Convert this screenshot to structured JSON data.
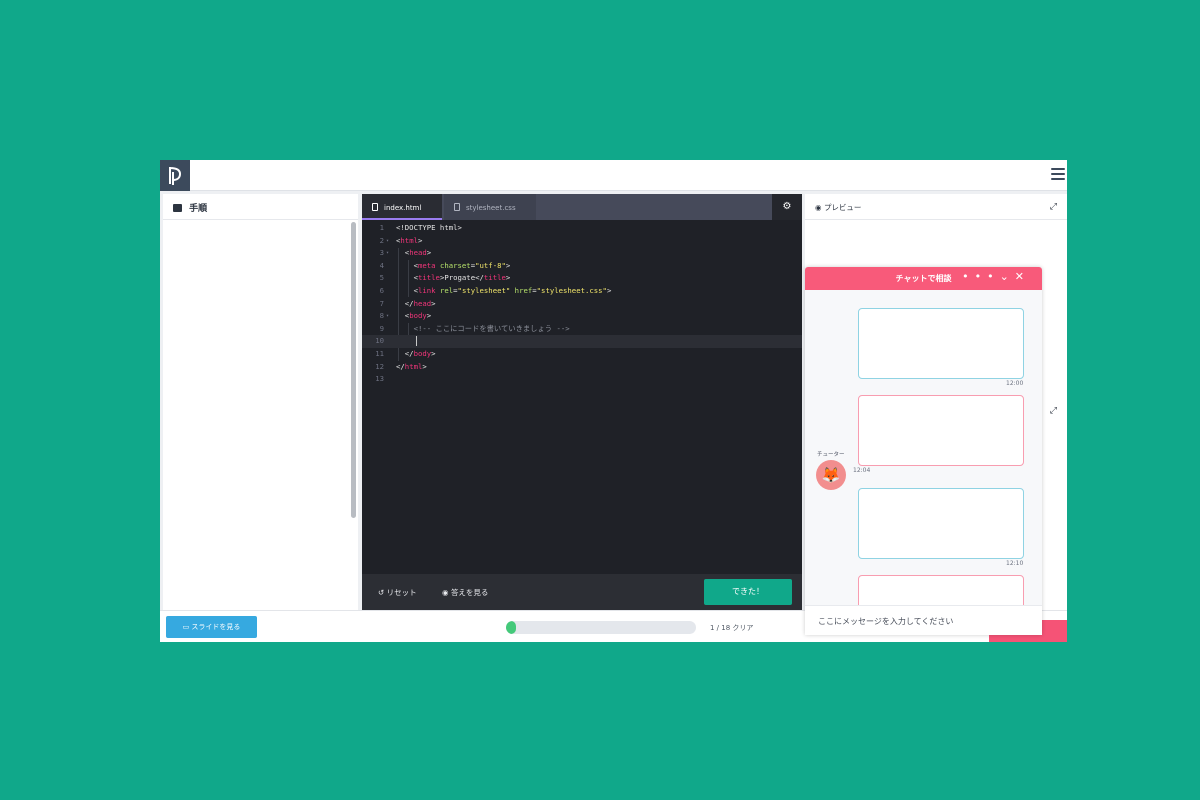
{
  "instructions": {
    "title": "手順"
  },
  "editor": {
    "tabs": [
      {
        "label": "index.html"
      },
      {
        "label": "stylesheet.css"
      }
    ],
    "lines": [
      "1",
      "2",
      "3",
      "4",
      "5",
      "6",
      "7",
      "8",
      "9",
      "10",
      "11",
      "12",
      "13"
    ],
    "code": {
      "l1": "<!DOCTYPE html>",
      "html": "html",
      "head": "head",
      "meta": "meta",
      "charset_attr": "charset",
      "charset_val": "\"utf-8\"",
      "title": "title",
      "title_text": "Progate",
      "link": "link",
      "rel_attr": "rel",
      "rel_val": "\"stylesheet\"",
      "href_attr": "href",
      "href_val": "\"stylesheet.css\"",
      "body": "body",
      "comment": "<!-- ここにコードを書いていきましょう -->"
    },
    "reset_label": "リセット",
    "answer_label": "答えを見る",
    "done_label": "できた！"
  },
  "preview": {
    "title": "プレビュー"
  },
  "bottom": {
    "slides_label": "スライドを見る",
    "progress_fraction": 0.05,
    "progress_text": "1 / 18 クリア"
  },
  "chat": {
    "title": "チャットで相談",
    "tutor_name": "チューター",
    "times": [
      "12:00",
      "12:04",
      "12:10"
    ],
    "input_placeholder": "ここにメッセージを入力してください"
  },
  "colors": {
    "accent": "#10a88a",
    "chat": "#f85a7a",
    "slides": "#36a9e0"
  }
}
